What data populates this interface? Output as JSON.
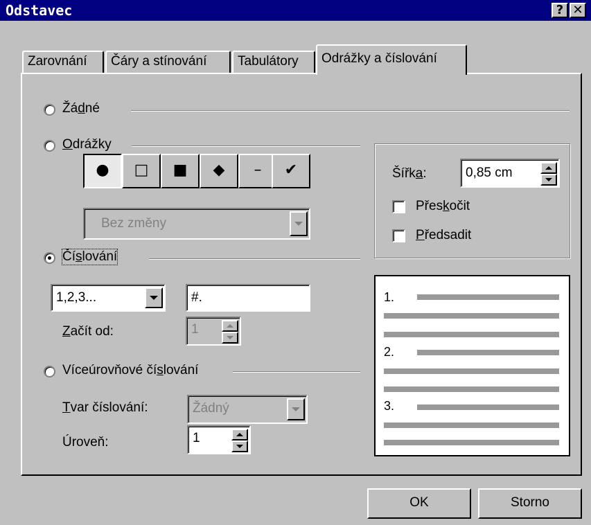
{
  "window": {
    "title": "Odstavec",
    "help_glyph": "?",
    "close_glyph": "✕"
  },
  "tabs": [
    {
      "label": "Zarovnání",
      "active": false
    },
    {
      "label": "Čáry a stínování",
      "active": false
    },
    {
      "label": "Tabulátory",
      "active": false
    },
    {
      "label": "Odrážky a číslování",
      "active": true
    }
  ],
  "options": {
    "none": {
      "pre": "Žá",
      "u": "d",
      "post": "né"
    },
    "bullets": {
      "pre": "",
      "u": "O",
      "post": "drážky"
    },
    "numbering": {
      "pre": "Čí",
      "u": "s",
      "post": "lování"
    },
    "multilevel": {
      "pre": "Víceúrovňové čí",
      "u": "s",
      "post": "lování"
    }
  },
  "bullet_symbols": [
    {
      "glyph": "●",
      "name": "bullet-filled-circle",
      "pressed": true
    },
    {
      "glyph": "□",
      "name": "bullet-hollow-square",
      "pressed": false
    },
    {
      "glyph": "■",
      "name": "bullet-filled-square",
      "pressed": false
    },
    {
      "glyph": "◆",
      "name": "bullet-diamond",
      "pressed": false
    },
    {
      "glyph": "–",
      "name": "bullet-dash",
      "pressed": false
    },
    {
      "glyph": "✔",
      "name": "bullet-checkmark",
      "pressed": false
    }
  ],
  "bullet_change_select": {
    "value": "Bez změny"
  },
  "numbering": {
    "format_value": "1,2,3...",
    "text_value": "#.",
    "start_label": {
      "pre": "",
      "u": "Z",
      "post": "ačít od:"
    },
    "start_value": "1"
  },
  "multilevel": {
    "shape_label": {
      "pre": "",
      "u": "T",
      "post": "var číslování:"
    },
    "shape_value": "Žádný",
    "level_label": "Úroveň:",
    "level_value": "1"
  },
  "indent_group": {
    "width_label": {
      "pre": "Šířk",
      "u": "a",
      "post": ":"
    },
    "width_value": "0,85 cm",
    "skip_label": {
      "pre": "Přes",
      "u": "k",
      "post": "očit"
    },
    "hanging_label": {
      "pre": "",
      "u": "P",
      "post": "ředsadit"
    }
  },
  "preview": {
    "numbers": [
      "1.",
      "2.",
      "3."
    ]
  },
  "buttons": {
    "ok": "OK",
    "cancel": "Storno"
  },
  "colors": {
    "titlebar": "#000080",
    "face": "#c0c0c0",
    "preview_lines": "#999999"
  }
}
